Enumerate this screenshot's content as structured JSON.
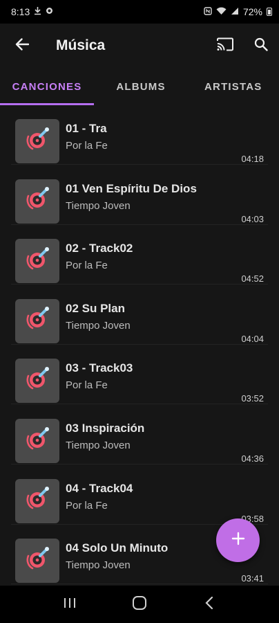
{
  "status_bar": {
    "time": "8:13",
    "battery": "72%"
  },
  "app_bar": {
    "title": "Música"
  },
  "tabs": [
    {
      "label": "CANCIONES",
      "active": true
    },
    {
      "label": "ALBUMS",
      "active": false
    },
    {
      "label": "ARTISTAS",
      "active": false
    }
  ],
  "songs": [
    {
      "title": "01 - Tra",
      "artist": "Por la Fe",
      "duration": "04:18"
    },
    {
      "title": "01 Ven Espíritu De Dios",
      "artist": "Tiempo Joven",
      "duration": "04:03"
    },
    {
      "title": "02 - Track02",
      "artist": "Por la Fe",
      "duration": "04:52"
    },
    {
      "title": "02 Su Plan",
      "artist": "Tiempo Joven",
      "duration": "04:04"
    },
    {
      "title": "03 - Track03",
      "artist": "Por la Fe",
      "duration": "03:52"
    },
    {
      "title": "03 Inspiración",
      "artist": "Tiempo Joven",
      "duration": "04:36"
    },
    {
      "title": "04 - Track04",
      "artist": "Por la Fe",
      "duration": "03:58"
    },
    {
      "title": "04 Solo Un Minuto",
      "artist": "Tiempo Joven",
      "duration": "03:41"
    }
  ],
  "fab": {
    "icon": "plus-icon"
  },
  "colors": {
    "accent": "#c77ff5",
    "fab": "#c06ee6",
    "background": "#161616",
    "thumb": "#4a4a4a",
    "record": "#f0566b"
  }
}
